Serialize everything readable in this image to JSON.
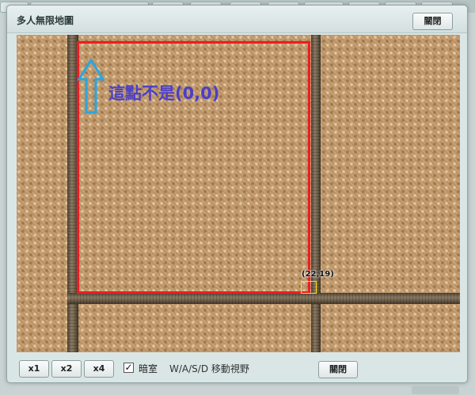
{
  "dialog": {
    "title": "多人無限地圖",
    "close_top_label": "關閉",
    "close_bottom_label": "關閉"
  },
  "map": {
    "coord_label": "(22,19)",
    "annotation": "這點不是(0,0)",
    "highlight_color": "#ee1c24",
    "arrow_color": "#2aa6e0",
    "annotation_color": "#4a3fc9"
  },
  "toolbar": {
    "zoom_buttons": [
      "x1",
      "x2",
      "x4"
    ],
    "dark_room_label": "暗室",
    "dark_room_checked": true,
    "check_mark": "✓",
    "hint": "W/A/S/D 移動視野"
  }
}
